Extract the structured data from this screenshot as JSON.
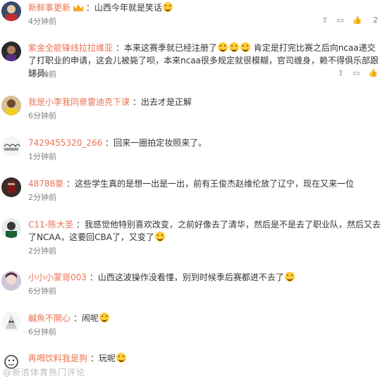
{
  "comments": [
    {
      "user": "新鲜事更新",
      "text": "：山西今年就是笑话",
      "time": "4分钟前",
      "likes": "2"
    },
    {
      "user": "紫金全能锋线拉拉维亚",
      "text": "：本来这赛季就已经注册了",
      "text2": "肯定是打完比赛之后向ncaa递交了打职业的申请，这会儿被毙了呗，本来ncaa很多规定就很模糊，官司缠身，赖不得俱乐部跟球员。",
      "time": "3分钟前"
    },
    {
      "user": "我是小李我同意雷迪克下课",
      "text": "：出去才是正解",
      "time": "6分钟前"
    },
    {
      "user": "7429455320_266",
      "text": "：回来一圈拍定妆照来了。",
      "time": "1分钟前"
    },
    {
      "user": "48788豪",
      "text": "：这些学生真的是想一出是一出，前有王俊杰赵维伦放了辽宁，现在又来一位",
      "time": "2分钟前"
    },
    {
      "user": "C11-陈大圣",
      "text": "：我感觉他特别喜欢改变，之前好像去了清华，然后是不是去了职业队，然后又去了NCAA，这要回CBA了，又变了",
      "time": "2分钟前"
    },
    {
      "user": "小小小蒙哥003",
      "text": "：山西这波操作没看懂，别到时候季后赛都进不去了",
      "time": "6分钟前"
    },
    {
      "user": "鹹魚不開心",
      "text": "：闹呢",
      "time": "6分钟前"
    },
    {
      "user": "再喝饮料我是狗",
      "text": "：玩呢",
      "time": ""
    }
  ],
  "watermark": "@新浪体育热门评论"
}
